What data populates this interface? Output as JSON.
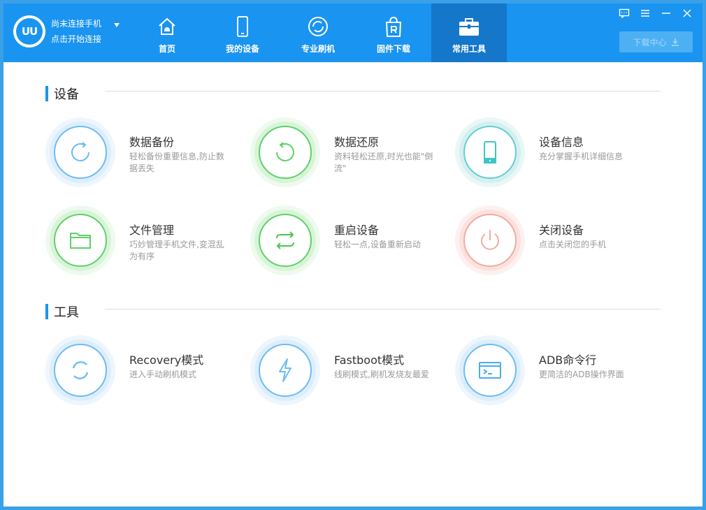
{
  "user": {
    "logo_text": "UU",
    "status": "尚未连接手机",
    "action": "点击开始连接"
  },
  "nav": [
    {
      "label": "首页",
      "icon": "android-home-icon"
    },
    {
      "label": "我的设备",
      "icon": "phone-icon"
    },
    {
      "label": "专业刷机",
      "icon": "flash-circle-icon"
    },
    {
      "label": "固件下载",
      "icon": "rom-bag-icon"
    },
    {
      "label": "常用工具",
      "icon": "toolbox-icon",
      "active": true
    }
  ],
  "window_controls": [
    "feedback-icon",
    "menu-icon",
    "minimize-icon",
    "close-icon"
  ],
  "download_center": {
    "label": "下载中心"
  },
  "sections": {
    "device": {
      "title": "设备",
      "tools": [
        {
          "title": "数据备份",
          "desc": "轻松备份重要信息,防止数据丢失",
          "icon": "backup-icon",
          "color": "#6cbcf2"
        },
        {
          "title": "数据还原",
          "desc": "资料轻松还原,时光也能\"倒流\"",
          "icon": "restore-icon",
          "color": "#5fd06a"
        },
        {
          "title": "设备信息",
          "desc": "充分掌握手机详细信息",
          "icon": "device-info-icon",
          "color": "#5fd0cf"
        },
        {
          "title": "文件管理",
          "desc": "巧妙管理手机文件,变混乱为有序",
          "icon": "folder-icon",
          "color": "#5fd06a"
        },
        {
          "title": "重启设备",
          "desc": "轻松一点,设备重新启动",
          "icon": "reboot-icon",
          "color": "#5fd06a"
        },
        {
          "title": "关闭设备",
          "desc": "点击关闭您的手机",
          "icon": "power-icon",
          "color": "#f4aaa0"
        }
      ]
    },
    "tools": {
      "title": "工具",
      "tools": [
        {
          "title": "Recovery模式",
          "desc": "进入手动刷机模式",
          "icon": "recovery-icon",
          "color": "#6cbcf2"
        },
        {
          "title": "Fastboot模式",
          "desc": "线刷模式,刷机发烧友最爱",
          "icon": "lightning-icon",
          "color": "#6cbcf2"
        },
        {
          "title": "ADB命令行",
          "desc": "更简洁的ADB操作界面",
          "icon": "terminal-icon",
          "color": "#6cbcf2"
        }
      ]
    }
  }
}
